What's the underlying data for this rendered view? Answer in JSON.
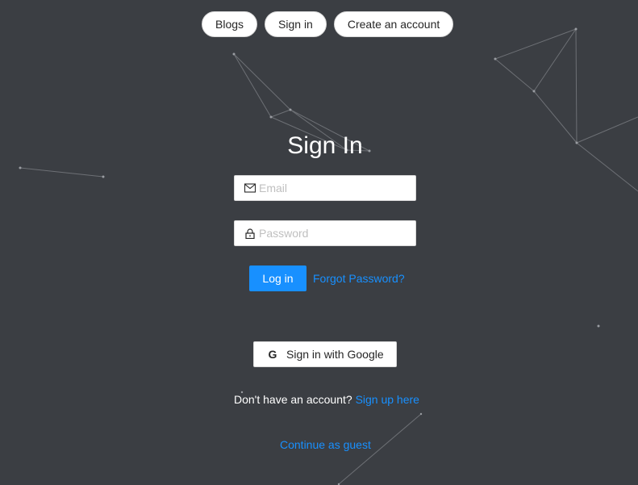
{
  "nav": {
    "blogs": "Blogs",
    "sign_in": "Sign in",
    "create_account": "Create an account"
  },
  "form": {
    "title": "Sign In",
    "email_placeholder": "Email",
    "password_placeholder": "Password",
    "login_label": "Log in",
    "forgot_label": "Forgot Password?",
    "google_label": "Sign in with Google",
    "google_icon_letter": "G",
    "no_account_text": "Don't have an account?",
    "signup_link": "Sign up here",
    "guest_link": "Continue as guest"
  },
  "icons": {
    "email": "mail-icon",
    "password": "lock-icon",
    "google": "google-icon"
  },
  "colors": {
    "background": "#3b3e43",
    "primary": "#1890ff",
    "text_light": "#ffffff"
  }
}
